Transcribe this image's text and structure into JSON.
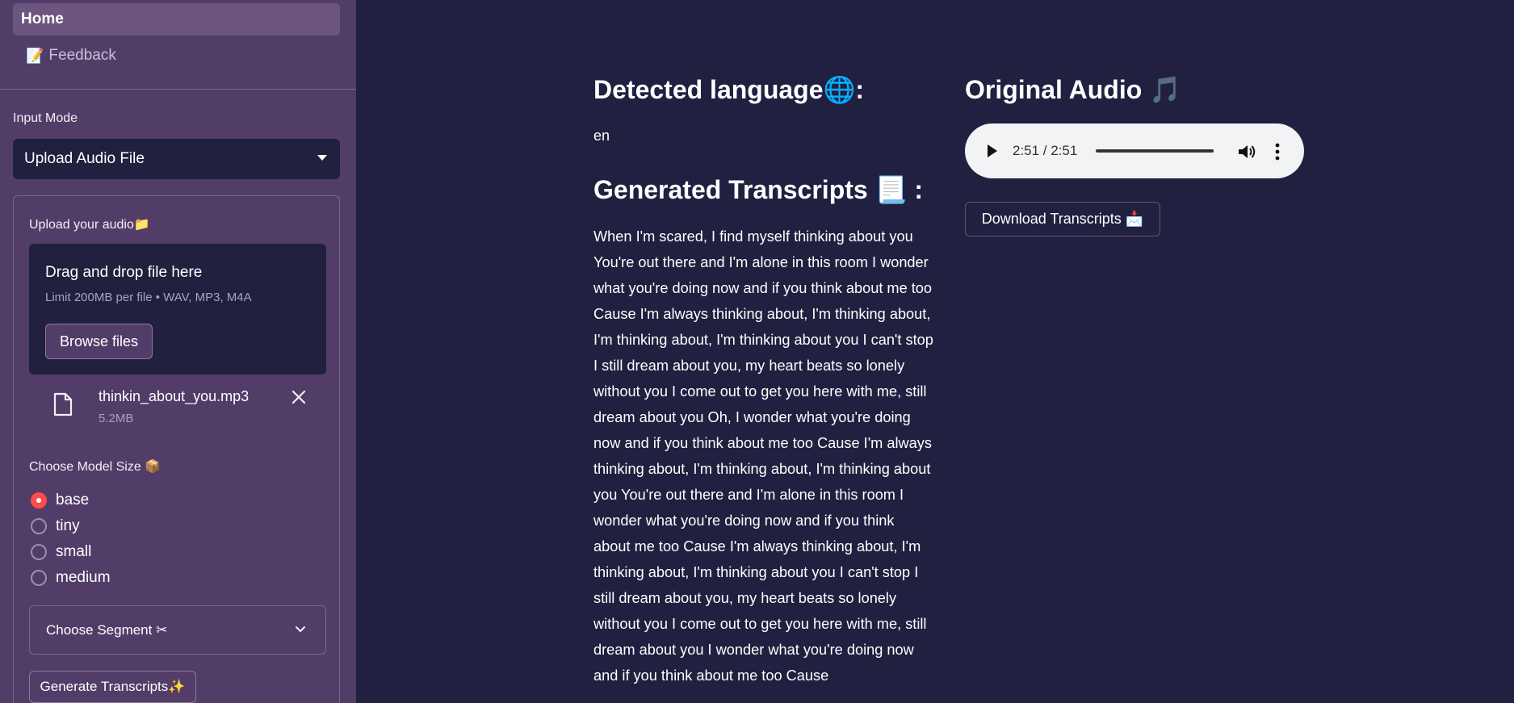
{
  "sidebar": {
    "nav": [
      {
        "label": "Home",
        "icon": "home"
      },
      {
        "label": "Feedback",
        "icon": "memo-icon",
        "emoji": "📝"
      }
    ],
    "input_mode": {
      "label": "Input Mode",
      "value": "Upload Audio File"
    },
    "uploader": {
      "label": "Upload your audio",
      "label_emoji": "📁",
      "drop_title": "Drag and drop file here",
      "limit": "Limit 200MB per file • WAV, MP3, M4A",
      "browse_label": "Browse files",
      "file": {
        "name": "thinkin_about_you.mp3",
        "size": "5.2MB"
      }
    },
    "model": {
      "label": "Choose Model Size",
      "label_emoji": "📦",
      "options": [
        "base",
        "tiny",
        "small",
        "medium"
      ],
      "selected": "base"
    },
    "segment": {
      "label": "Choose Segment",
      "emoji": "✂"
    },
    "generate": {
      "label": "Generate Transcripts",
      "emoji": "✨"
    }
  },
  "main": {
    "detected": {
      "heading": "Detected language",
      "emoji": "🌐",
      "suffix": ":",
      "value": "en"
    },
    "generated": {
      "heading": "Generated Transcripts",
      "emoji": "📃",
      "suffix": ":",
      "text": "When I'm scared, I find myself thinking about you You're out there and I'm alone in this room I wonder what you're doing now and if you think about me too Cause I'm always thinking about, I'm thinking about, I'm thinking about, I'm thinking about you I can't stop I still dream about you, my heart beats so lonely without you I come out to get you here with me, still dream about you Oh, I wonder what you're doing now and if you think about me too Cause I'm always thinking about, I'm thinking about, I'm thinking about you You're out there and I'm alone in this room I wonder what you're doing now and if you think about me too Cause I'm always thinking about, I'm thinking about, I'm thinking about you I can't stop I still dream about you, my heart beats so lonely without you I come out to get you here with me, still dream about you I wonder what you're doing now and if you think about me too Cause"
    },
    "audio": {
      "heading": "Original Audio",
      "emoji": "🎵",
      "time": "2:51 / 2:51",
      "progress": 1.0
    },
    "download": {
      "label": "Download Transcripts",
      "emoji": "📩"
    }
  },
  "colors": {
    "background": "#212041",
    "sidebar": "#523d69",
    "accent": "#ff4b4b"
  }
}
